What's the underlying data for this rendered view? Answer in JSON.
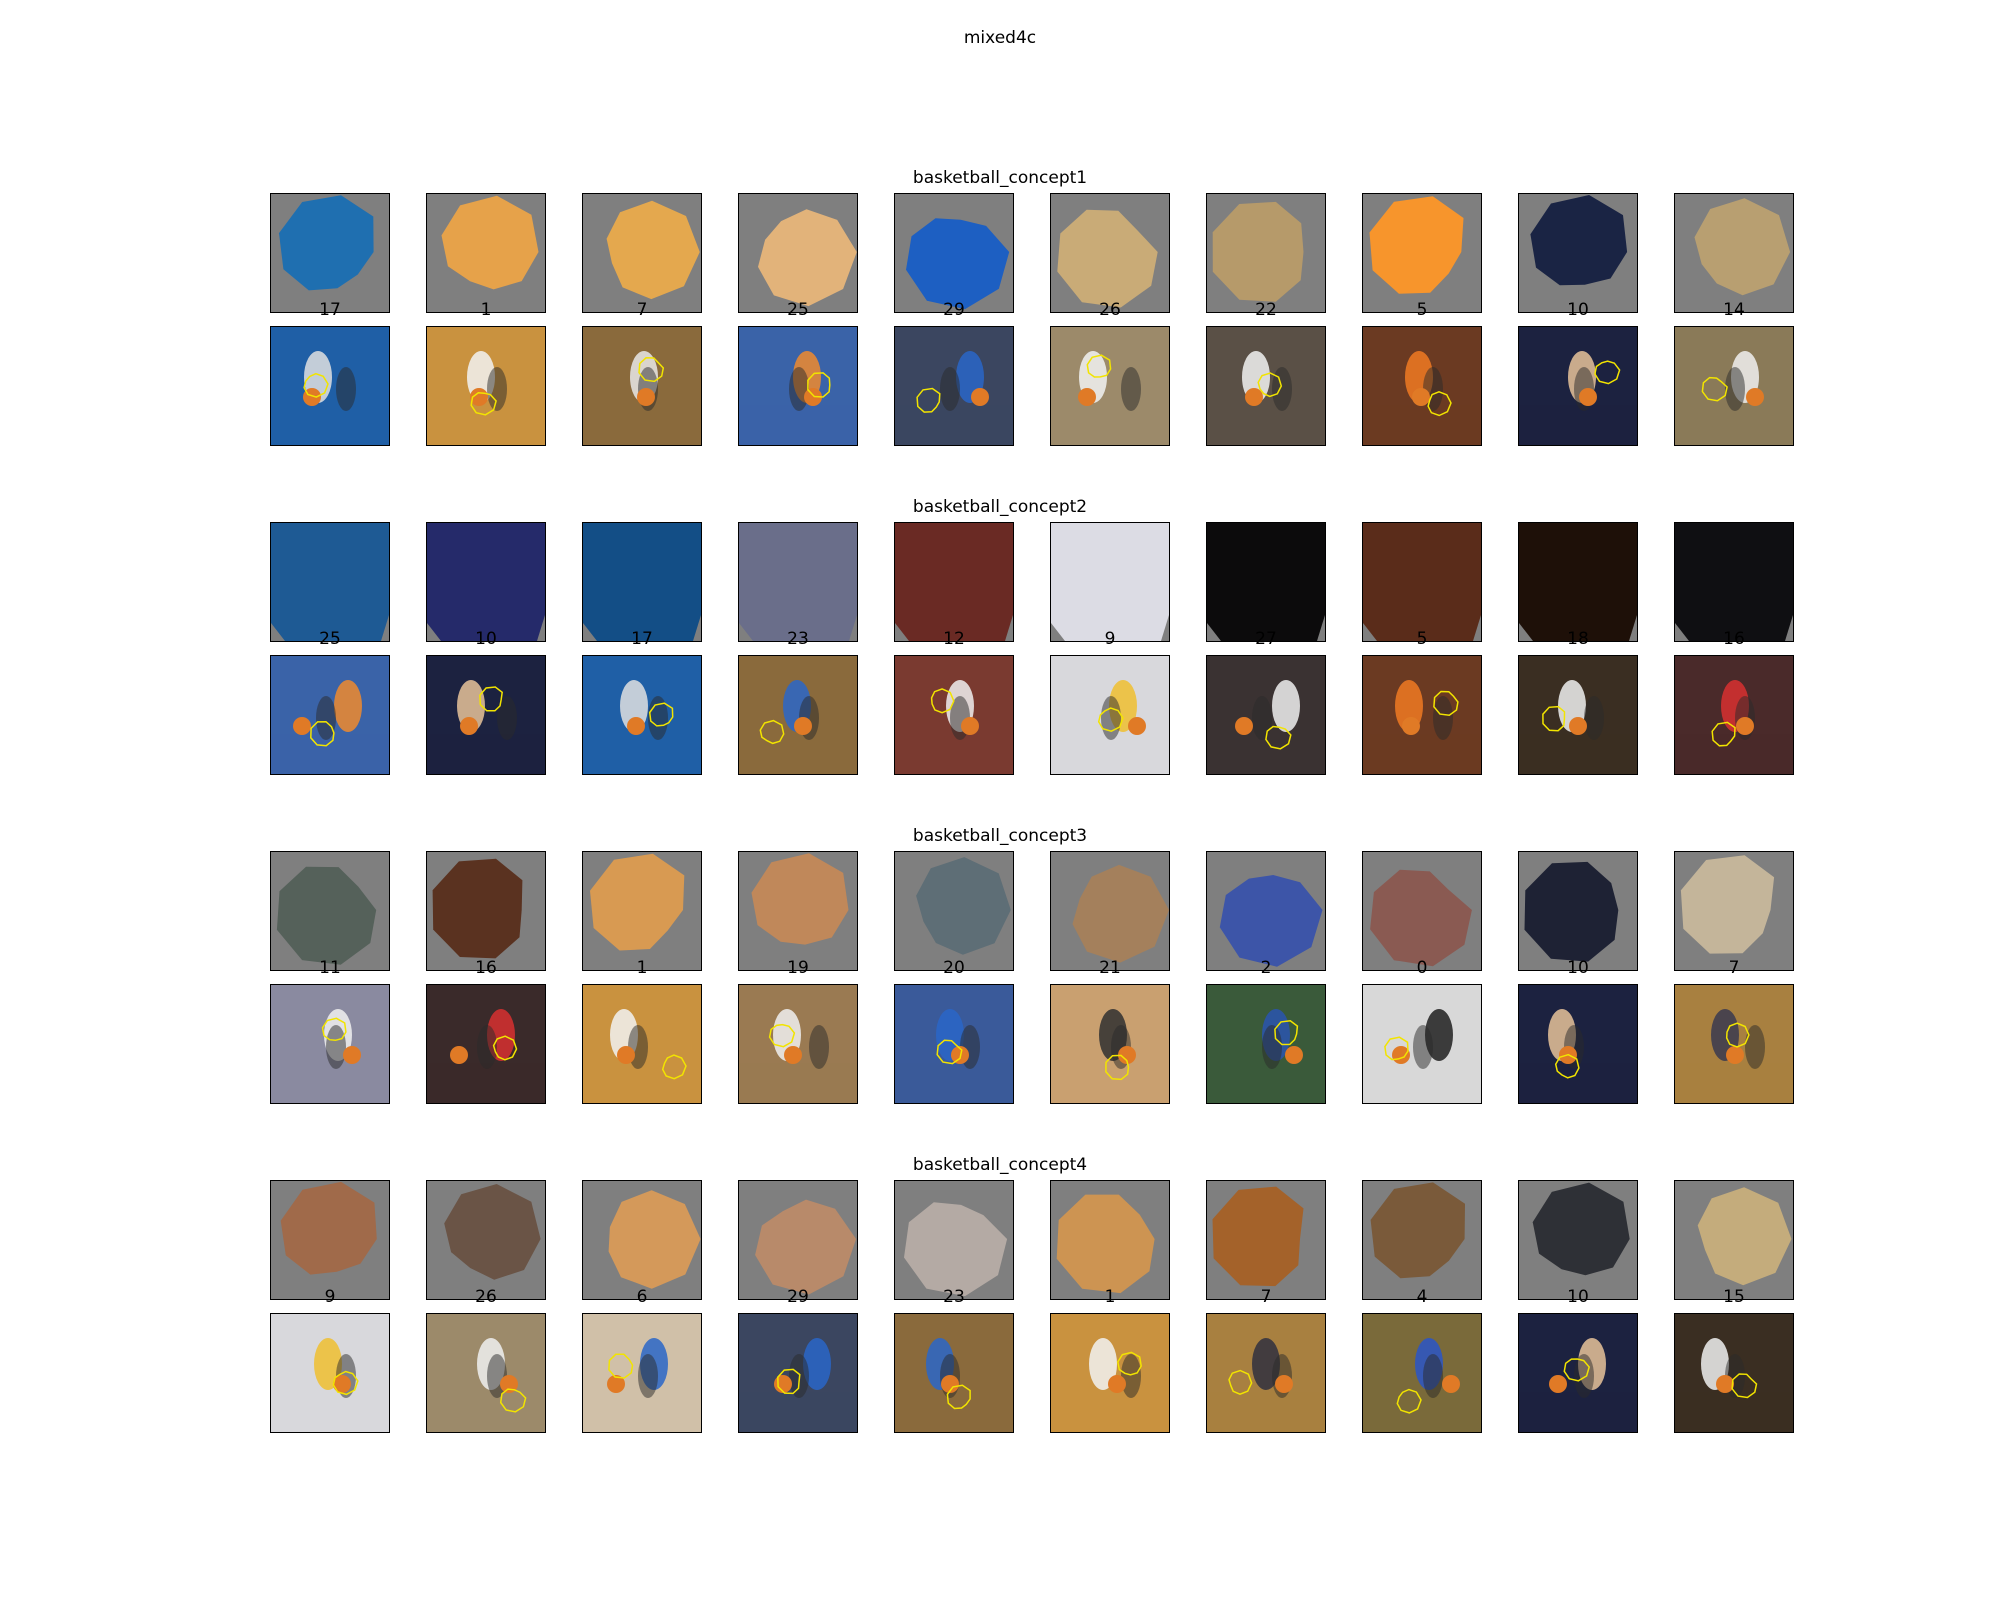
{
  "figure": {
    "title": "mixed4c",
    "concepts": [
      {
        "name": "basketball_concept1",
        "labels": [
          "17",
          "1",
          "7",
          "25",
          "29",
          "26",
          "22",
          "5",
          "10",
          "14"
        ],
        "patch_colors": [
          "#1f6fb0",
          "#e6a24a",
          "#e4a84e",
          "#e2b37a",
          "#1d5fc2",
          "#c9ab77",
          "#b69a6a",
          "#f7952c",
          "#1a2444",
          "#b89f71"
        ],
        "scene_colors": [
          "#1f5fa6",
          "#c9923f",
          "#8a6a3c",
          "#3a63a8",
          "#3b4660",
          "#9c8a6a",
          "#5a5046",
          "#6b3a22",
          "#1c2240",
          "#8a7a58"
        ],
        "scene_accents": [
          "#e0e0e0",
          "#f2f2f2",
          "#e8e8e8",
          "#f08a2e",
          "#2a66c8",
          "#f2f2f2",
          "#f2f2f2",
          "#f07a22",
          "#e8c39a",
          "#f0f0f0"
        ]
      },
      {
        "name": "basketball_concept2",
        "labels": [
          "25",
          "10",
          "17",
          "23",
          "12",
          "9",
          "27",
          "5",
          "18",
          "16"
        ],
        "patch_colors": [
          "#1e5a94",
          "#252a6a",
          "#134e86",
          "#6a6e8a",
          "#6a2a24",
          "#dcdce4",
          "#0c0b0c",
          "#5a2c1a",
          "#1e1008",
          "#0f0f12"
        ],
        "scene_colors": [
          "#3a63a8",
          "#1c2240",
          "#1f5fa6",
          "#8a6a3c",
          "#7a3a30",
          "#d8d8dc",
          "#3a3232",
          "#6b3a22",
          "#3a2e22",
          "#4a2a2a"
        ],
        "scene_accents": [
          "#f08a2e",
          "#e8c39a",
          "#e0e0e0",
          "#2a66c8",
          "#f0f0f0",
          "#f0c030",
          "#f0f0f0",
          "#f07a22",
          "#f0f0f0",
          "#d83030"
        ]
      },
      {
        "name": "basketball_concept3",
        "labels": [
          "11",
          "16",
          "1",
          "19",
          "20",
          "21",
          "2",
          "0",
          "10",
          "7"
        ],
        "patch_colors": [
          "#55615a",
          "#5a3220",
          "#d89a52",
          "#c0885a",
          "#5e6e76",
          "#a4805c",
          "#3d55a8",
          "#8a5a52",
          "#1e2234",
          "#c4b59a"
        ],
        "scene_colors": [
          "#8a8aa0",
          "#3a2a2a",
          "#c9923f",
          "#9a7a52",
          "#3a5a9a",
          "#c9a070",
          "#3a5a3a",
          "#d8d8d8",
          "#1c2240",
          "#a88040"
        ],
        "scene_accents": [
          "#f0f0f0",
          "#d83030",
          "#f2f2f2",
          "#f0f0f0",
          "#2a66c8",
          "#303030",
          "#2a55b0",
          "#202020",
          "#e8c39a",
          "#3a3a50"
        ]
      },
      {
        "name": "basketball_concept4",
        "labels": [
          "9",
          "26",
          "6",
          "29",
          "23",
          "1",
          "7",
          "4",
          "10",
          "15"
        ],
        "patch_colors": [
          "#a06a4a",
          "#6a5446",
          "#d4995a",
          "#b88a6a",
          "#b4aaa4",
          "#cd9452",
          "#a4622a",
          "#7a5a3a",
          "#2e3036",
          "#c4ac7c"
        ],
        "scene_colors": [
          "#d8d8dc",
          "#9c8a6a",
          "#d0c0a8",
          "#3b4660",
          "#8a6a3c",
          "#c9923f",
          "#a88040",
          "#7a6a3a",
          "#1c2240",
          "#3a2e22"
        ],
        "scene_accents": [
          "#f0c030",
          "#f0f0f0",
          "#2a66c8",
          "#2a66c8",
          "#2a66c8",
          "#f2f2f2",
          "#303040",
          "#2a55c8",
          "#e8c39a",
          "#f0f0f0"
        ]
      }
    ]
  }
}
